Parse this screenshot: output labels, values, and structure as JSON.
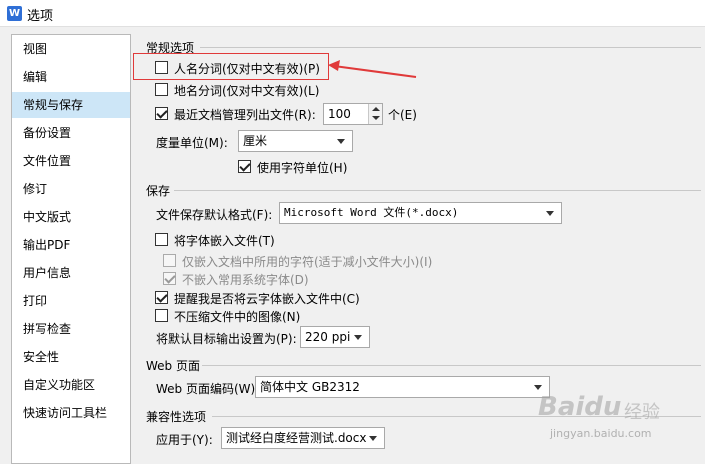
{
  "window": {
    "title": "选项",
    "app_icon_letter": "W"
  },
  "sidebar": {
    "items": [
      {
        "label": "视图"
      },
      {
        "label": "编辑"
      },
      {
        "label": "常规与保存",
        "selected": true
      },
      {
        "label": "备份设置"
      },
      {
        "label": "文件位置"
      },
      {
        "label": "修订"
      },
      {
        "label": "中文版式"
      },
      {
        "label": "输出PDF"
      },
      {
        "label": "用户信息"
      },
      {
        "label": "打印"
      },
      {
        "label": "拼写检查"
      },
      {
        "label": "安全性"
      },
      {
        "label": "自定义功能区"
      },
      {
        "label": "快速访问工具栏"
      }
    ]
  },
  "general": {
    "title": "常规选项",
    "person_name_seg": {
      "label": "人名分词(仅对中文有效)(P)",
      "checked": false
    },
    "place_name_seg": {
      "label": "地名分词(仅对中文有效)(L)",
      "checked": false
    },
    "recent_docs": {
      "label": "最近文档管理列出文件(R):",
      "checked": true,
      "value": "100",
      "unit": "个(E)"
    },
    "measure_unit": {
      "label": "度量单位(M):",
      "value": "厘米"
    },
    "char_unit": {
      "label": "使用字符单位(H)",
      "checked": true
    }
  },
  "save": {
    "title": "保存",
    "default_format": {
      "label": "文件保存默认格式(F):",
      "value": "Microsoft Word 文件(*.docx)"
    },
    "embed_fonts": {
      "label": "将字体嵌入文件(T)",
      "checked": false
    },
    "embed_used_only": {
      "label": "仅嵌入文档中所用的字符(适于减小文件大小)(I)",
      "checked": false,
      "disabled": true
    },
    "no_embed_system": {
      "label": "不嵌入常用系统字体(D)",
      "checked": true,
      "disabled": true
    },
    "remind_cloud_fonts": {
      "label": "提醒我是否将云字体嵌入文件中(C)",
      "checked": true
    },
    "no_compress_images": {
      "label": "不压缩文件中的图像(N)",
      "checked": false
    },
    "output_target": {
      "label": "将默认目标输出设置为(P):",
      "value": "220 ppi"
    }
  },
  "web": {
    "title": "Web 页面",
    "encoding": {
      "label": "Web 页面编码(W):",
      "value": "简体中文 GB2312"
    }
  },
  "compat": {
    "title": "兼容性选项",
    "apply_to": {
      "label": "应用于(Y):",
      "value": "测试经白度经营测试.docx"
    }
  },
  "annotation": {
    "highlight_color": "#e03a3a"
  },
  "watermark": {
    "logo_text": "Baidu",
    "cn_text": "经验",
    "url": "jingyan.baidu.com"
  }
}
